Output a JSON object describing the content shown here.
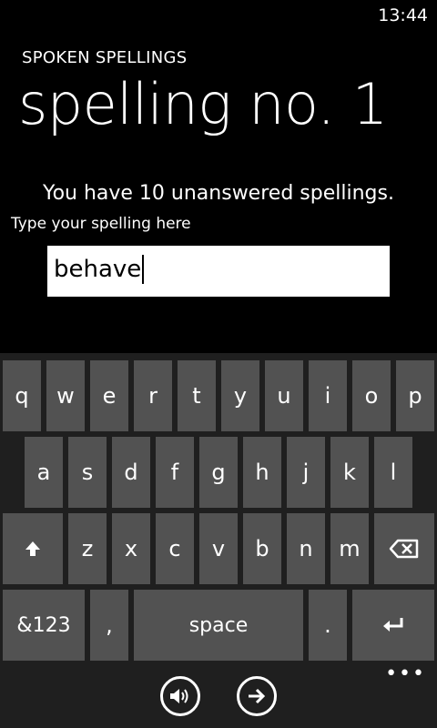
{
  "status": {
    "time": "13:44"
  },
  "app": {
    "title": "SPOKEN SPELLINGS"
  },
  "page": {
    "title": "spelling no. 1"
  },
  "main": {
    "unanswered_text": "You have 10 unanswered spellings.",
    "hint": "Type your spelling here",
    "answer_value": "behave"
  },
  "keyboard": {
    "row1": [
      "q",
      "w",
      "e",
      "r",
      "t",
      "y",
      "u",
      "i",
      "o",
      "p"
    ],
    "row2": [
      "a",
      "s",
      "d",
      "f",
      "g",
      "h",
      "j",
      "k",
      "l"
    ],
    "row3": [
      "z",
      "x",
      "c",
      "v",
      "b",
      "n",
      "m"
    ],
    "numbers_label": "&123",
    "comma_label": ",",
    "space_label": "space",
    "period_label": "."
  },
  "appbar": {
    "more_label": "•••",
    "buttons": [
      {
        "icon": "speaker-icon"
      },
      {
        "icon": "arrow-right-icon"
      }
    ]
  }
}
